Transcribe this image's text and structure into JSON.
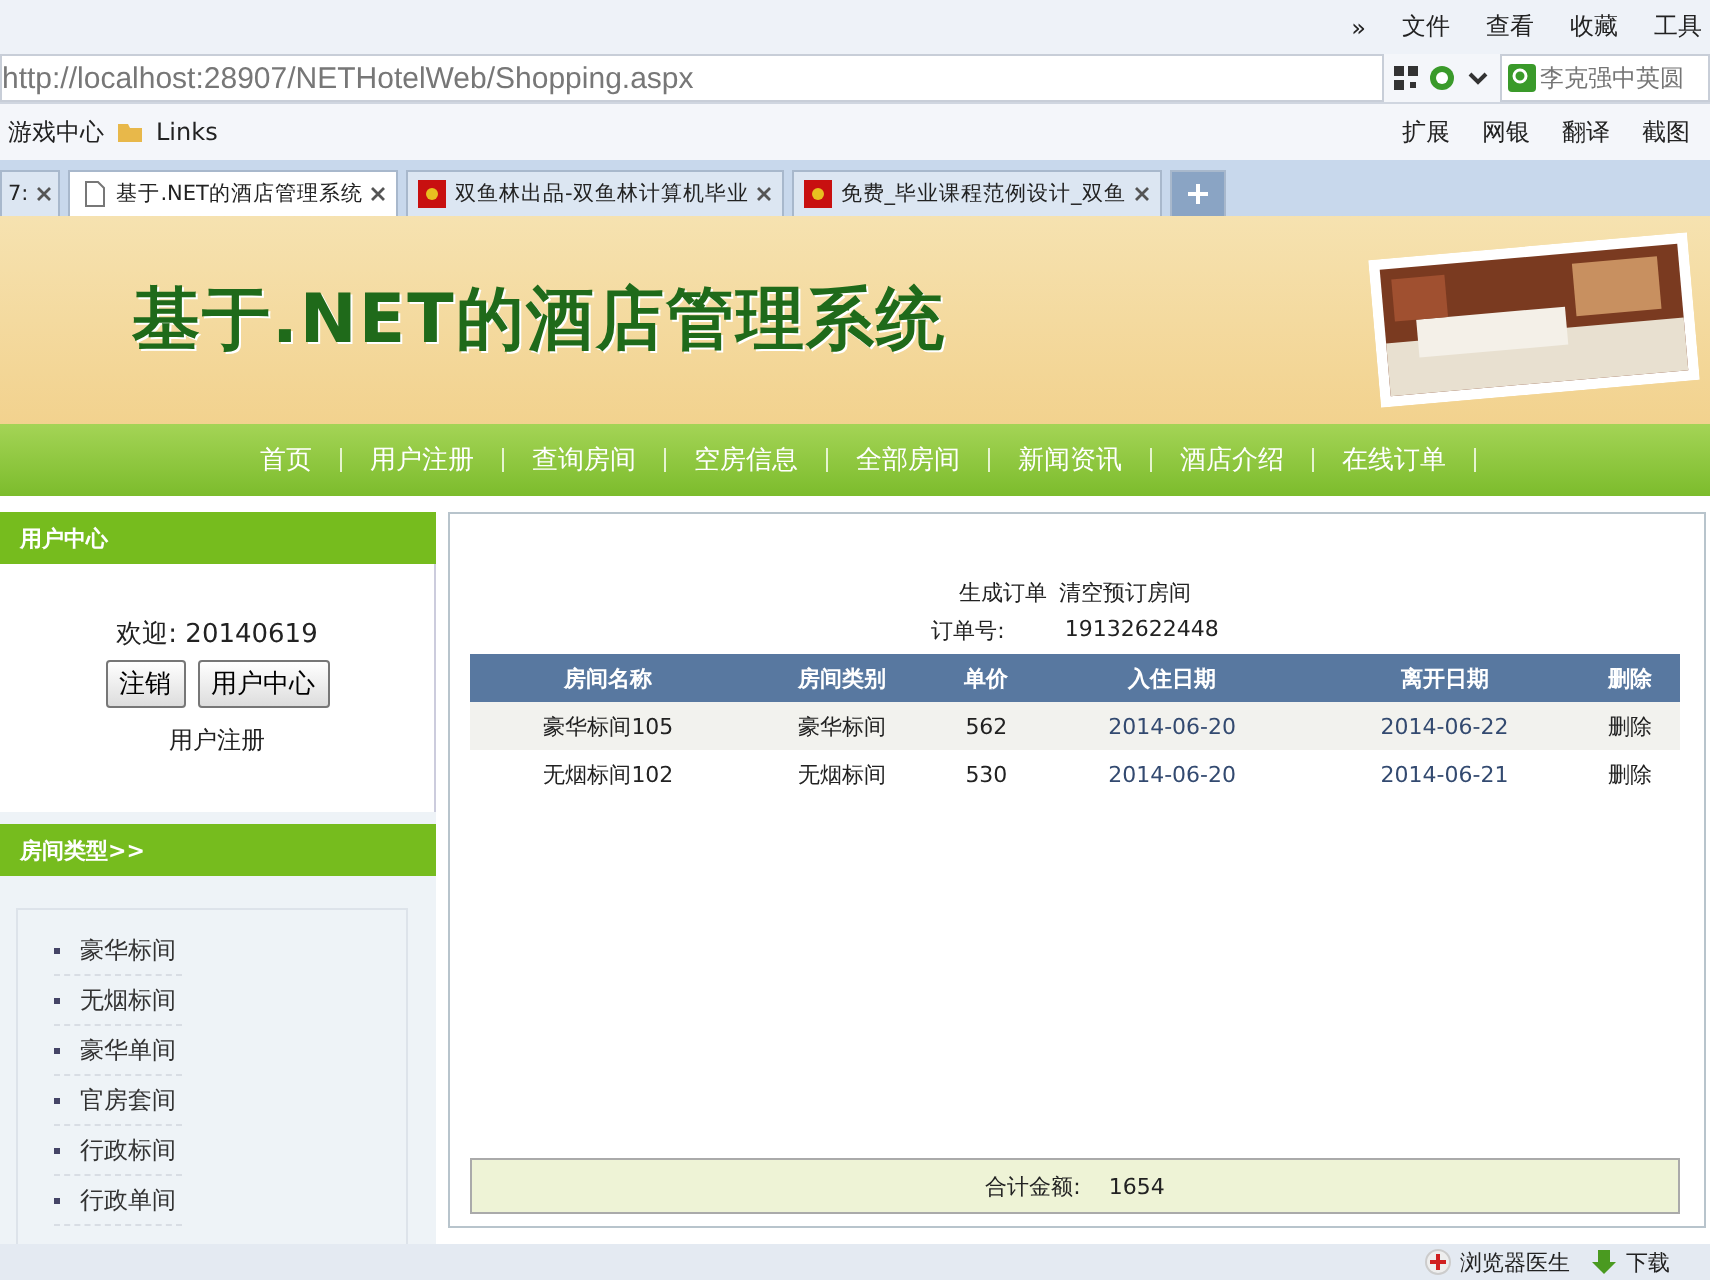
{
  "browser": {
    "menu": [
      "»",
      "文件",
      "查看",
      "收藏",
      "工具"
    ],
    "address": "http://localhost:28907/NETHotelWeb/Shopping.aspx",
    "search": {
      "placeholder": "李克强中英圆"
    },
    "bookmarks": [
      "游戏中心",
      "Links"
    ],
    "toolbar": [
      "扩展",
      "网银",
      "翻译",
      "截图"
    ],
    "tabs": [
      {
        "title": "7:",
        "selected": false,
        "kind": "plain"
      },
      {
        "title": "基于.NET的酒店管理系统",
        "selected": true,
        "kind": "page"
      },
      {
        "title": "双鱼林出品-双鱼林计算机毕业",
        "selected": false,
        "kind": "site"
      },
      {
        "title": "免费_毕业课程范例设计_双鱼",
        "selected": false,
        "kind": "site"
      }
    ],
    "status": [
      "浏览器医生",
      "下载"
    ]
  },
  "banner": {
    "title": "基于.NET的酒店管理系统"
  },
  "nav": [
    "首页",
    "用户注册",
    "查询房间",
    "空房信息",
    "全部房间",
    "新闻资讯",
    "酒店介绍",
    "在线订单"
  ],
  "user_panel": {
    "title": "用户中心",
    "welcome": "欢迎: 20140619",
    "buttons": [
      "注销",
      "用户中心"
    ],
    "link": "用户注册"
  },
  "room_types": {
    "title": "房间类型>>",
    "items": [
      "豪华标间",
      "无烟标间",
      "豪华单间",
      "官房套间",
      "行政标间",
      "行政单间"
    ]
  },
  "cart": {
    "actions": [
      "生成订单",
      "清空预订房间"
    ],
    "order_label": "订单号:",
    "order_no": "19132622448",
    "columns": [
      "房间名称",
      "房间类别",
      "单价",
      "入住日期",
      "离开日期",
      "删除"
    ],
    "rows": [
      [
        "豪华标间105",
        "豪华标间",
        "562",
        "2014-06-20",
        "2014-06-22",
        "删除"
      ],
      [
        "无烟标间102",
        "无烟标间",
        "530",
        "2014-06-20",
        "2014-06-21",
        "删除"
      ]
    ],
    "total_label": "合计金额:",
    "total": "1654"
  }
}
